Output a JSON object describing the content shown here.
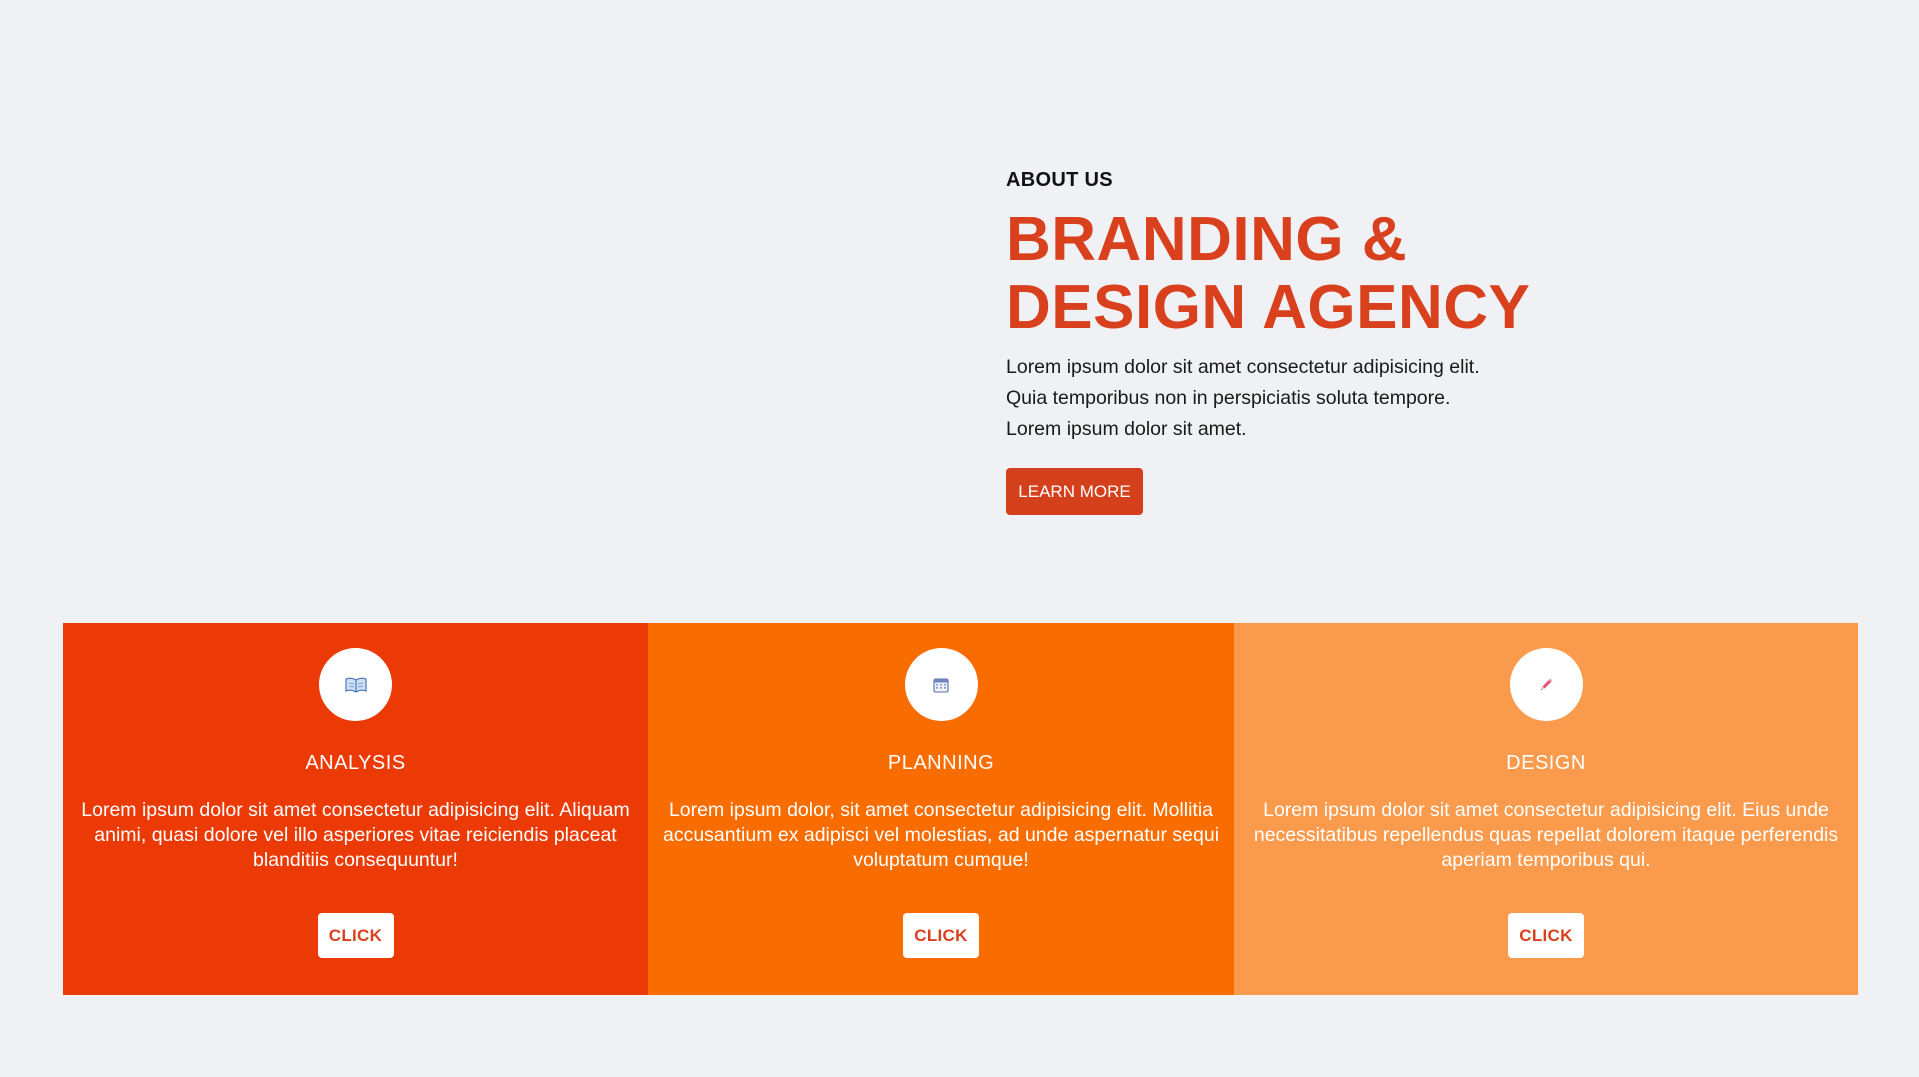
{
  "about": {
    "eyebrow": "ABOUT US",
    "headline_lines": [
      "BRANDING &",
      "DESIGN AGENCY"
    ],
    "description_lines": [
      "Lorem ipsum dolor sit amet consectetur adipisicing elit.",
      "Quia temporibus non in perspiciatis soluta tempore.",
      "Lorem ipsum dolor sit amet."
    ],
    "button_label": "LEARN MORE"
  },
  "services": [
    {
      "icon": "open-book-icon",
      "title": "ANALYSIS",
      "text_lines": [
        "Lorem ipsum dolor sit amet consectetur adipisicing elit. Aliquam",
        "animi, quasi dolore vel illo asperiores vitae reiciendis placeat",
        "blanditiis consequuntur!"
      ],
      "button_label": "CLICK",
      "color": "#eb3a06"
    },
    {
      "icon": "calendar-icon",
      "title": "PLANNING",
      "text_lines": [
        "Lorem ipsum dolor, sit amet consectetur adipisicing elit. Mollitia",
        "accusantium ex adipisci vel molestias, ad unde aspernatur sequi",
        "voluptatum cumque!"
      ],
      "button_label": "CLICK",
      "color": "#f96c00"
    },
    {
      "icon": "pencil-icon",
      "title": "DESIGN",
      "text_lines": [
        "Lorem ipsum dolor sit amet consectetur adipisicing elit. Eius unde",
        "necessitatibus repellendus quas repellat dolorem itaque perferendis",
        "aperiam temporibus qui."
      ],
      "button_label": "CLICK",
      "color": "#fa9a4c"
    }
  ],
  "colors": {
    "background": "#f0f1f4",
    "accent": "#d9401d",
    "button": "#d5401c"
  }
}
